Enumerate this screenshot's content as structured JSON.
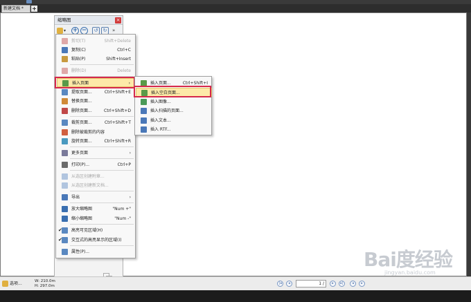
{
  "tabs": [
    {
      "label": "新建文档 *"
    }
  ],
  "new_tab_label": "+",
  "thumbnail_panel": {
    "title": "缩略图",
    "close_label": "×",
    "options_caret": "▾",
    "zoom_in": "+",
    "zoom_out": "−",
    "more": "»"
  },
  "context_menu": {
    "items": [
      {
        "label": "剪切(T)",
        "shortcut": "Shift+Delete",
        "disabled": true,
        "icon": "scissors-icon",
        "color": "#c04848"
      },
      {
        "label": "复制(C)",
        "shortcut": "Ctrl+C",
        "icon": "copy-icon",
        "color": "#4a78b8"
      },
      {
        "label": "粘贴(P)",
        "shortcut": "Shift+Insert",
        "icon": "paste-icon",
        "color": "#c89a40"
      },
      {
        "label": "删除(D)",
        "shortcut": "Delete",
        "disabled": true,
        "icon": "trash-icon",
        "color": "#c04848"
      },
      {
        "label": "插入页面",
        "arrow": "›",
        "highlighted": true,
        "icon": "insert-page-icon",
        "color": "#5a9a48"
      },
      {
        "label": "提取页面...",
        "shortcut": "Ctrl+Shift+E",
        "icon": "extract-page-icon",
        "color": "#5a88c0"
      },
      {
        "label": "替换页面...",
        "icon": "replace-page-icon",
        "color": "#d08a38"
      },
      {
        "label": "删除页面...",
        "shortcut": "Ctrl+Shift+D",
        "icon": "delete-page-icon",
        "color": "#c04848"
      },
      {
        "label": "裁剪页面...",
        "shortcut": "Ctrl+Shift+T",
        "icon": "crop-page-icon",
        "color": "#5a88c0"
      },
      {
        "label": "删除被裁剪的内容",
        "icon": "remove-cropped-icon",
        "color": "#d06040"
      },
      {
        "label": "旋转页面...",
        "shortcut": "Ctrl+Shift+R",
        "icon": "rotate-page-icon",
        "color": "#4a9ac0"
      },
      {
        "label": "更多页面",
        "arrow": "›",
        "icon": "more-pages-icon",
        "color": "#7a7a9a"
      },
      {
        "label": "打印(P)...",
        "shortcut": "Ctrl+P",
        "icon": "printer-icon",
        "color": "#6a6a6a"
      },
      {
        "label": "从选区创建附章...",
        "disabled": true,
        "icon": "stamp-from-selection-icon",
        "color": "#5a88c0"
      },
      {
        "label": "从选区创建新文档...",
        "disabled": true,
        "icon": "doc-from-selection-icon",
        "color": "#5a88c0"
      },
      {
        "label": "导出",
        "arrow": "›",
        "icon": "export-icon",
        "color": "#4a78b8"
      },
      {
        "label": "放大缩略图",
        "shortcut": "\"Num +\"",
        "icon": "zoom-in-icon",
        "color": "#3a6fb0"
      },
      {
        "label": "缩小缩略图",
        "shortcut": "\"Num -\"",
        "icon": "zoom-out-icon",
        "color": "#3a6fb0"
      },
      {
        "label": "高亮可见区域(H)",
        "check": "✔",
        "icon": "highlight-visible-icon",
        "color": "#5a88c0"
      },
      {
        "label": "交互式的高亮显示的区域(I)",
        "check": "✔",
        "icon": "interactive-highlight-icon",
        "color": "#5a88c0"
      },
      {
        "label": "属性(P)...",
        "icon": "properties-icon",
        "color": "#5a88c0"
      }
    ]
  },
  "sub_menu": {
    "items": [
      {
        "label": "插入页面...",
        "shortcut": "Ctrl+Shift+I",
        "icon": "insert-page-icon",
        "color": "#5a9a48"
      },
      {
        "label": "插入空白页面...",
        "highlighted": true,
        "icon": "insert-blank-page-icon",
        "color": "#5a9a48"
      },
      {
        "label": "插入图像...",
        "icon": "insert-image-icon",
        "color": "#4a9a58"
      },
      {
        "label": "插入扫描的页面...",
        "icon": "insert-scan-icon",
        "color": "#4a78b8"
      },
      {
        "label": "插入文本...",
        "icon": "insert-text-icon",
        "color": "#4a78b8"
      },
      {
        "label": "插入 RTF...",
        "icon": "insert-rtf-icon",
        "color": "#4a78b8"
      }
    ]
  },
  "status_bar": {
    "options_label": "选项...",
    "width_label": "W: 210.0m",
    "height_label": "H: 297.0m",
    "page_value": "1 /",
    "nav_first": "|◂",
    "nav_prev": "◂",
    "nav_next": "▸",
    "nav_last": "▸|",
    "nav_back": "◂",
    "nav_forward": "▸"
  },
  "watermark": {
    "logo": "Bai度经验",
    "site": "jingyan.baidu.com"
  },
  "colors": {
    "highlight_box": "#d6284b",
    "menu_highlight": "#fde9a8"
  }
}
